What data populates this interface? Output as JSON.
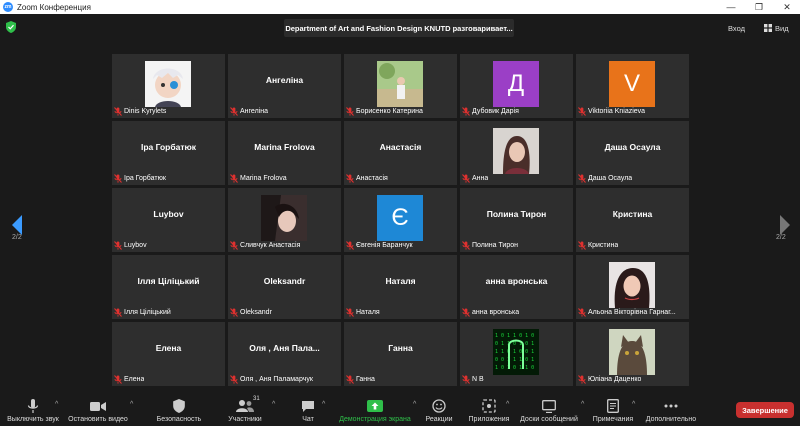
{
  "window": {
    "title": "Zoom Конференция"
  },
  "topbar": {
    "speaker": "Department of Art and Fashion Design KNUTD разговаривает...",
    "enter_label": "Вход",
    "view_label": "Вид"
  },
  "pager": {
    "left": "2/2",
    "right": "2/2"
  },
  "colors": {
    "accent_green": "#2fbf4a",
    "end_red": "#c8302f",
    "mute_red": "#e0312f",
    "tile_bg": "#2e2e2e"
  },
  "tiles": [
    {
      "label": "Dinis Kyrylets",
      "big": "",
      "kind": "avatar-cartoon"
    },
    {
      "label": "Ангеліна",
      "big": "Ангеліна",
      "kind": "name"
    },
    {
      "label": "Борисенко Катерина",
      "big": "",
      "kind": "photo-outdoor"
    },
    {
      "label": "Дубовик Дарія",
      "big": "Д",
      "kind": "letter",
      "color": "#9b3fc6"
    },
    {
      "label": "Viktoriia Kniazieva",
      "big": "V",
      "kind": "letter",
      "color": "#e8731a"
    },
    {
      "label": "Іра Горбатюк",
      "big": "Іра Горбатюк",
      "kind": "name"
    },
    {
      "label": "Marina Frolova",
      "big": "Marina Frolova",
      "kind": "name"
    },
    {
      "label": "Анастасія",
      "big": "Анастасія",
      "kind": "name"
    },
    {
      "label": "Анна",
      "big": "",
      "kind": "photo-portrait"
    },
    {
      "label": "Даша Осаула",
      "big": "Даша Осаула",
      "kind": "name"
    },
    {
      "label": "Luybov",
      "big": "Luybov",
      "kind": "name"
    },
    {
      "label": "Сливчук Анастасія",
      "big": "",
      "kind": "photo-dark"
    },
    {
      "label": "Євгенія Баранчук",
      "big": "Є",
      "kind": "letter",
      "color": "#1e88d6"
    },
    {
      "label": "Полина Тирон",
      "big": "Полина Тирон",
      "kind": "name"
    },
    {
      "label": "Кристина",
      "big": "Кристина",
      "kind": "name"
    },
    {
      "label": "Ілля Ціліцький",
      "big": "Ілля Ціліцький",
      "kind": "name"
    },
    {
      "label": "Oleksandr",
      "big": "Oleksandr",
      "kind": "name"
    },
    {
      "label": "Наталя",
      "big": "Наталя",
      "kind": "name"
    },
    {
      "label": "анна вронська",
      "big": "анна вронська",
      "kind": "name"
    },
    {
      "label": "Альона Вікторівна Гарнаг...",
      "big": "",
      "kind": "photo-woman"
    },
    {
      "label": "Елена",
      "big": "Елена",
      "kind": "name"
    },
    {
      "label": "Оля , Аня Паламарчук",
      "big": "Оля , Аня Пала...",
      "kind": "name"
    },
    {
      "label": "Ганна",
      "big": "Ганна",
      "kind": "name"
    },
    {
      "label": "N B",
      "big": "",
      "kind": "photo-matrix"
    },
    {
      "label": "Юліана Даценко",
      "big": "",
      "kind": "photo-cat"
    }
  ],
  "toolbar": {
    "mute": "Выключить звук",
    "video": "Остановить видео",
    "security": "Безопасность",
    "participants": "Участники",
    "participants_count": "31",
    "chat": "Чат",
    "share": "Демонстрация экрана",
    "reactions": "Реакции",
    "apps": "Приложения",
    "whiteboards": "Доски сообщений",
    "notes": "Примечания",
    "more": "Дополнительно",
    "end": "Завершение"
  },
  "icons": [
    "zoom-logo-icon",
    "shield-icon",
    "enter-icon",
    "view-grid-icon",
    "prev-page-icon",
    "next-page-icon",
    "mic-muted-icon",
    "microphone-icon",
    "video-camera-icon",
    "security-shield-icon",
    "participants-icon",
    "chat-icon",
    "share-screen-icon",
    "reactions-icon",
    "apps-icon",
    "whiteboard-icon",
    "notes-icon",
    "more-icon"
  ]
}
